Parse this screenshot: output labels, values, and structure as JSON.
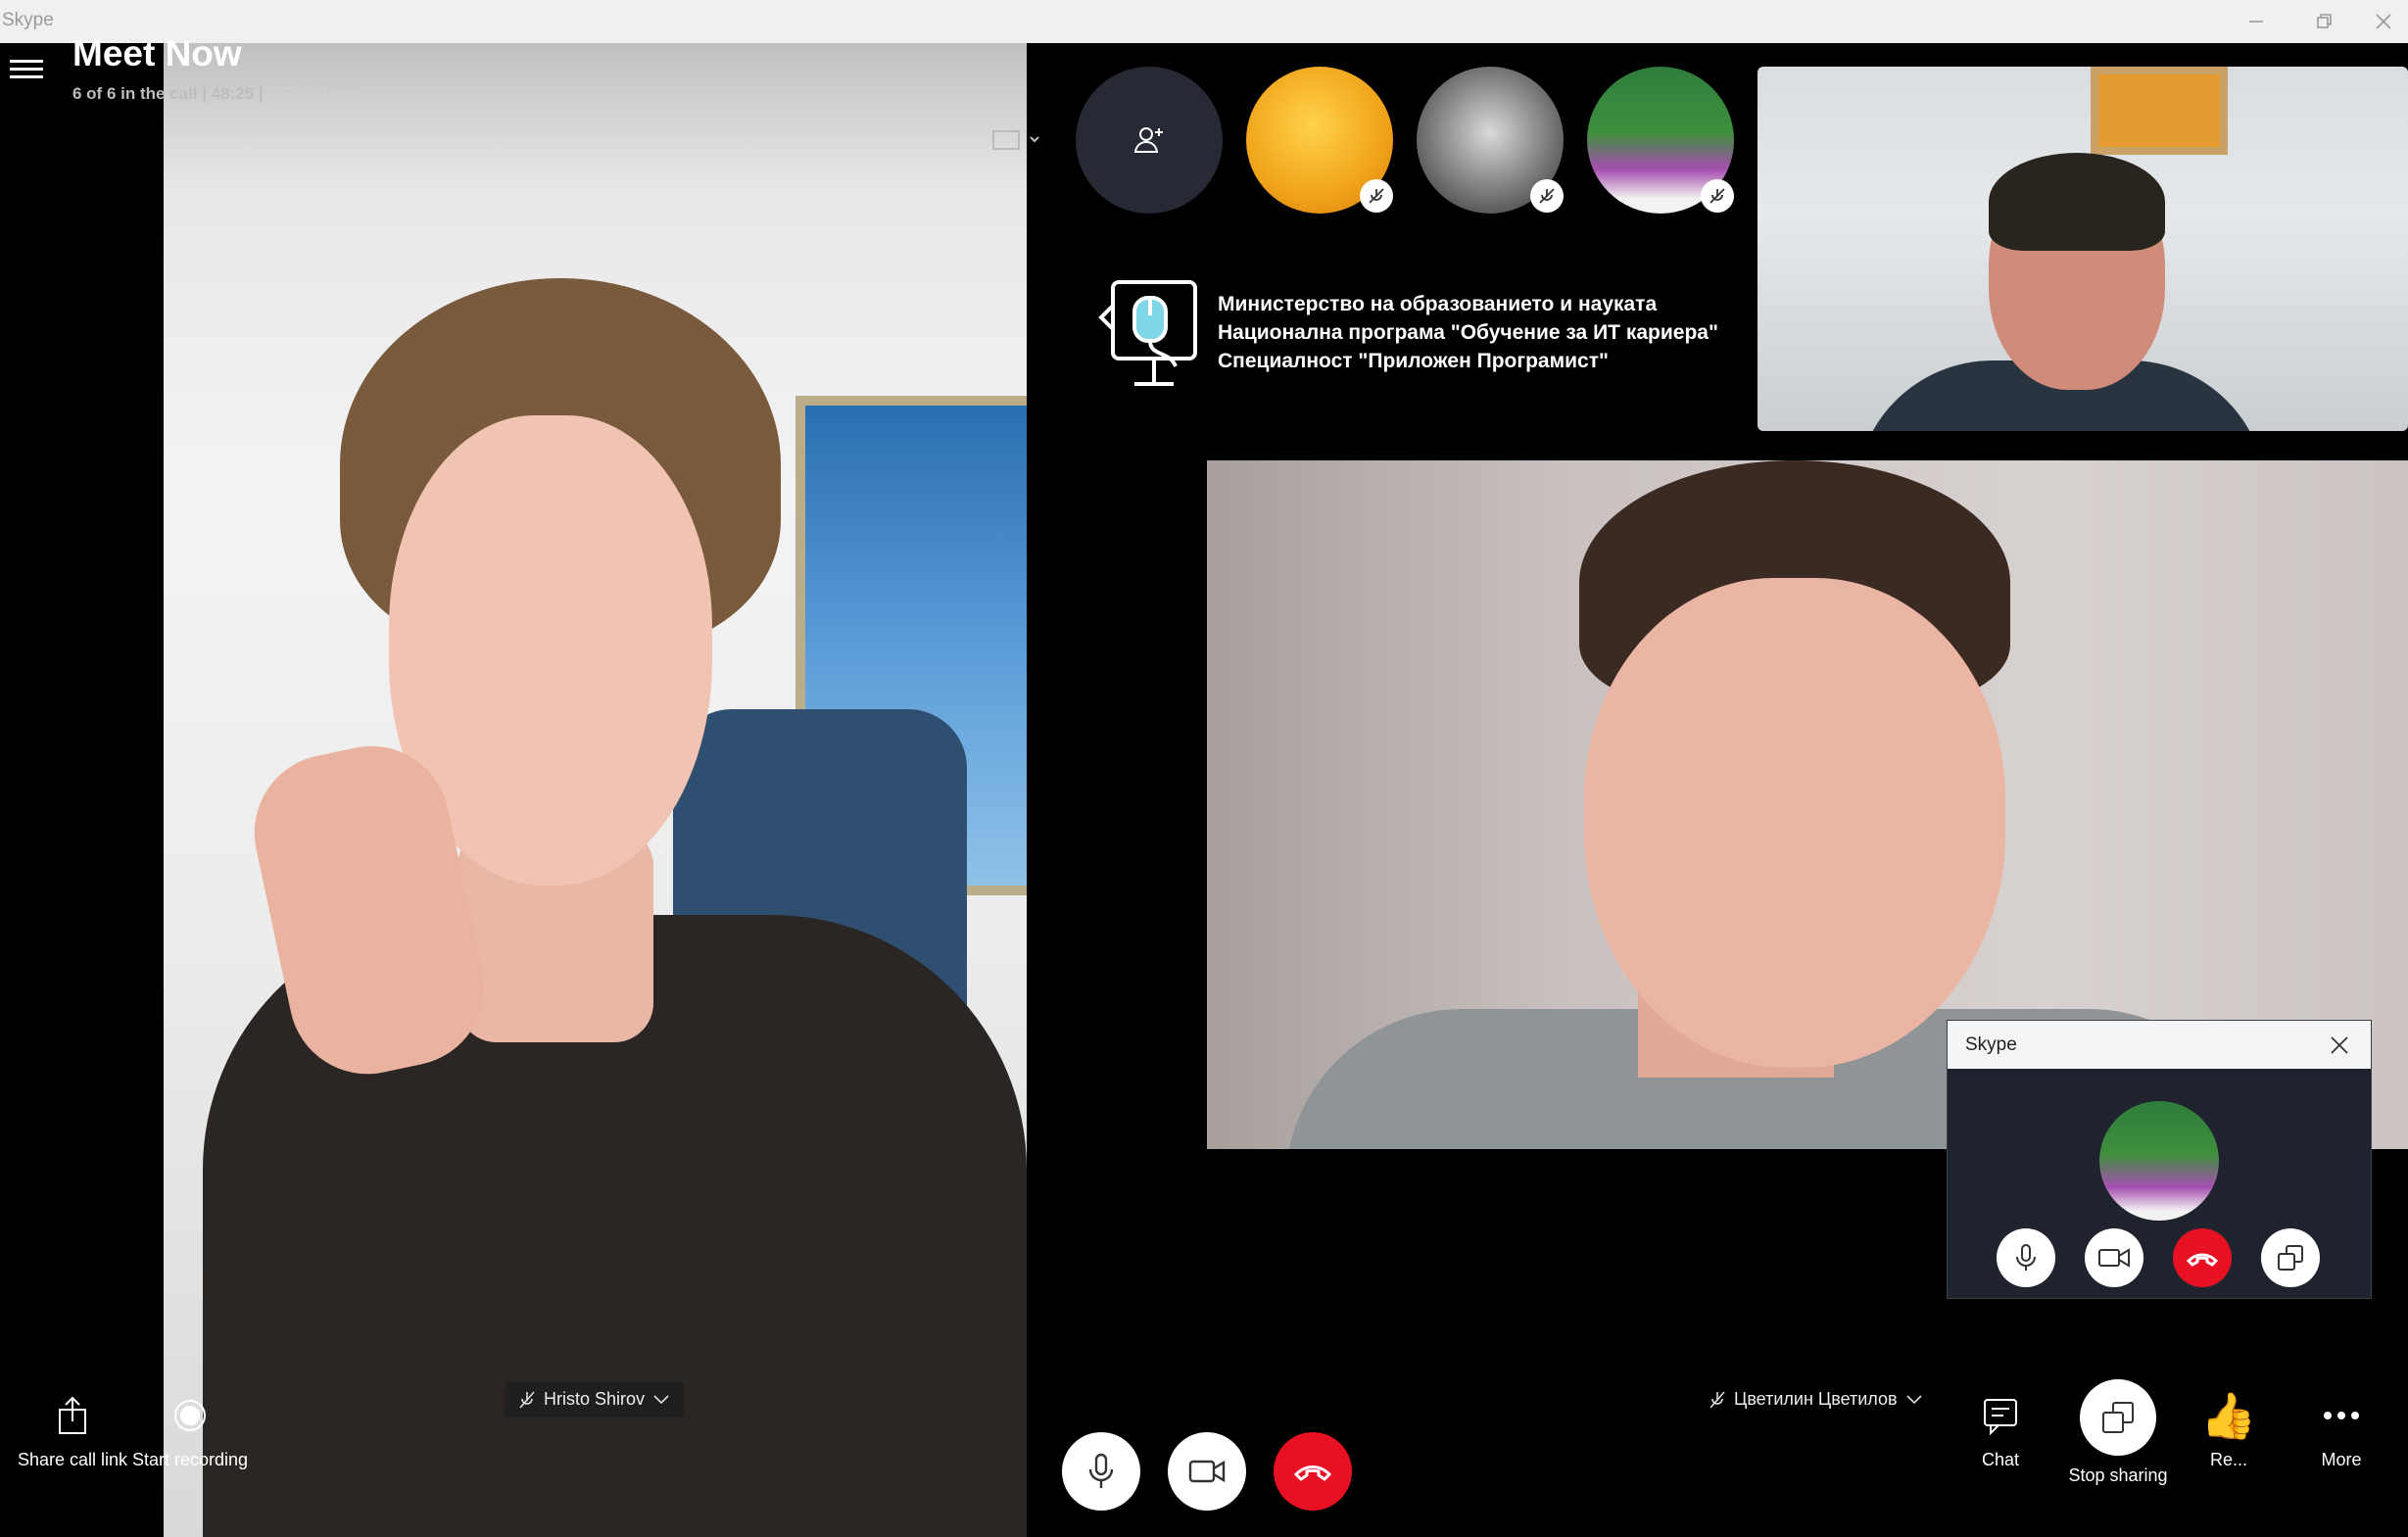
{
  "window": {
    "title": "Skype"
  },
  "call": {
    "title": "Meet Now",
    "status": "6 of 6 in the call | 48:25  |",
    "view": "Gallery"
  },
  "participants": {
    "left_name": "Hristo Shirov",
    "main_name": "Цветилин Цветилов"
  },
  "banner": {
    "line1": "Министерство на образованието и науката",
    "line2": "Национална програма \"Обучение за ИТ кариера\"",
    "line3": "Специалност \"Приложен Програмист\""
  },
  "left_actions": {
    "share_link": "Share call link",
    "start_recording": "Start recording"
  },
  "right_actions": {
    "chat": "Chat",
    "stop_sharing": "Stop sharing",
    "reactions": "Re...",
    "more": "More"
  },
  "mini_window": {
    "title": "Skype"
  },
  "colors": {
    "hangup": "#e81123",
    "background": "#000000",
    "panel": "#1f232e"
  },
  "icons": [
    "hamburger-menu-icon",
    "gallery-icon",
    "share-icon",
    "record-icon",
    "mic-muted-icon",
    "microphone-icon",
    "video-camera-icon",
    "hang-up-icon",
    "chat-icon",
    "stop-sharing-icon",
    "thumbs-up-icon",
    "more-icon",
    "add-person-icon",
    "close-icon"
  ]
}
